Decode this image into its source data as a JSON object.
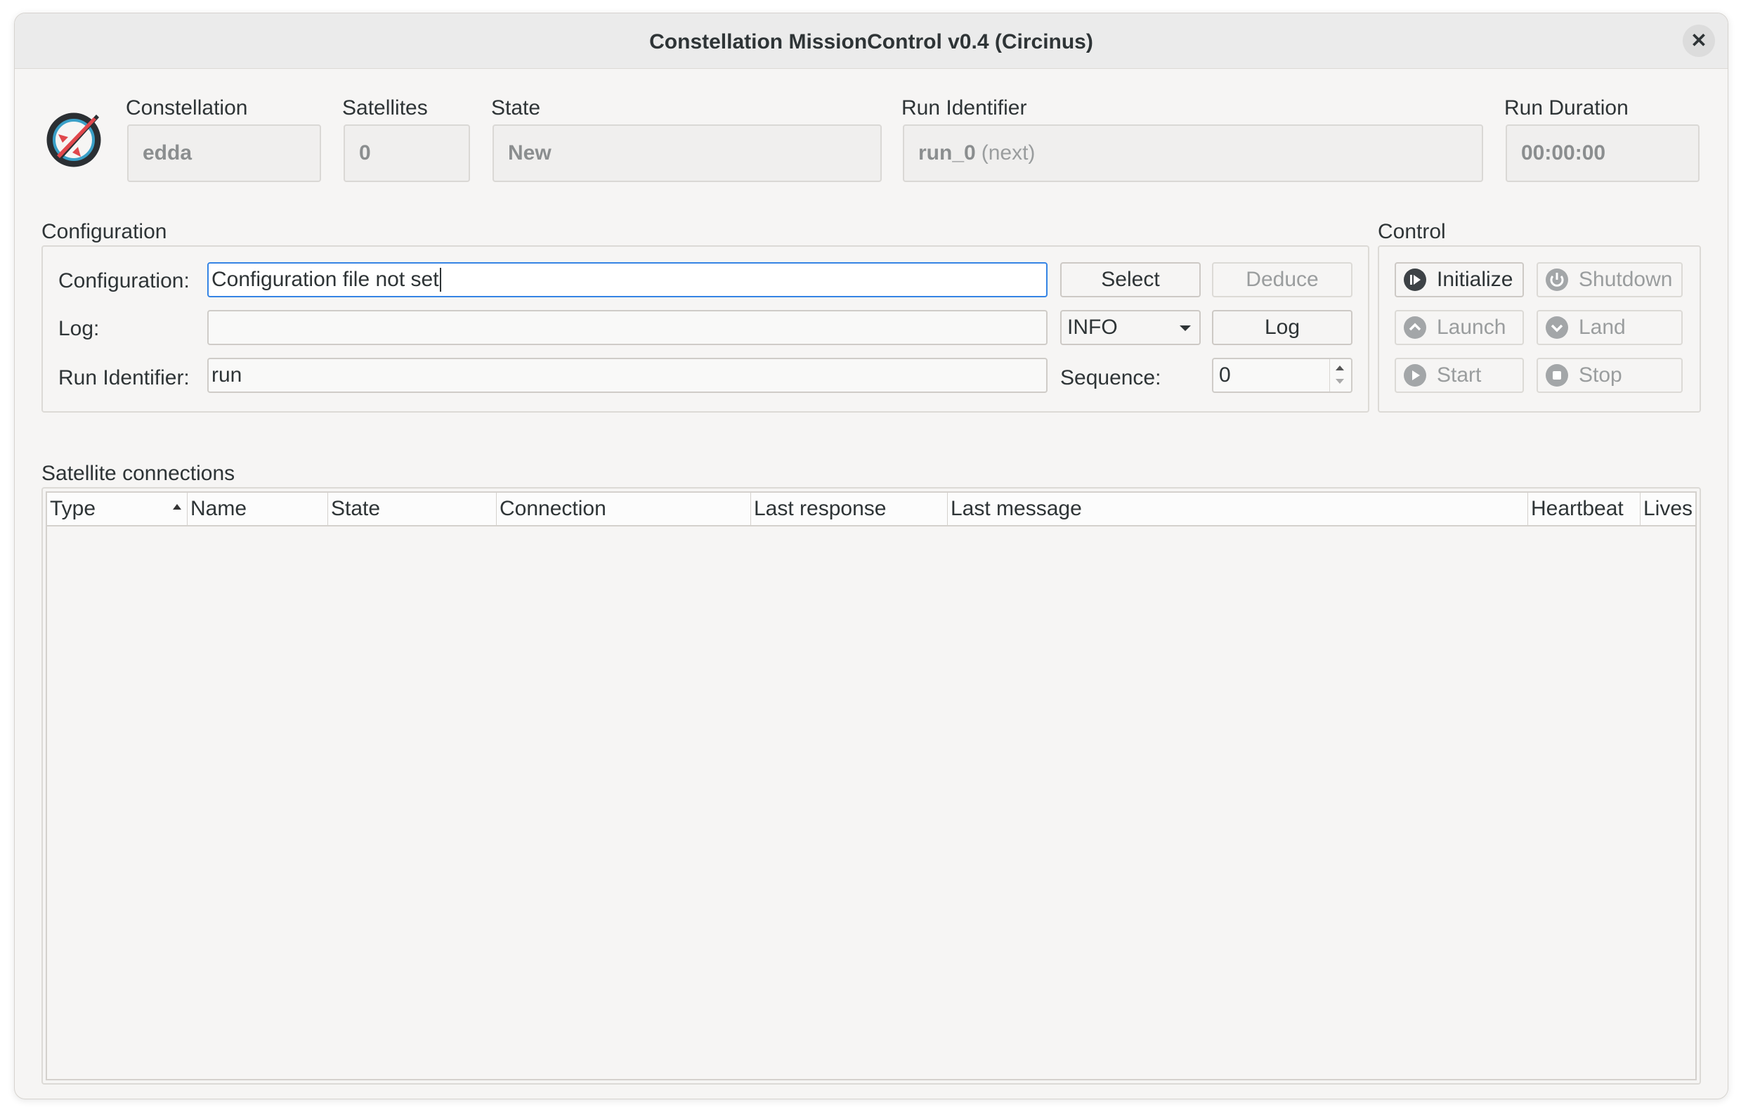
{
  "window": {
    "title": "Constellation MissionControl v0.4 (Circinus)",
    "close_glyph": "✕"
  },
  "header": {
    "constellation": {
      "label": "Constellation",
      "value": "edda"
    },
    "satellites": {
      "label": "Satellites",
      "value": "0"
    },
    "state": {
      "label": "State",
      "value": "New"
    },
    "run_identifier": {
      "label": "Run Identifier",
      "value": "run_0",
      "suffix": "(next)"
    },
    "run_duration": {
      "label": "Run Duration",
      "value": "00:00:00"
    }
  },
  "configuration": {
    "group_title": "Configuration",
    "config_label": "Configuration:",
    "config_value": "Configuration file not set",
    "select_label": "Select",
    "deduce_label": "Deduce",
    "log_label": "Log:",
    "log_value": "",
    "log_level": "INFO",
    "log_button": "Log",
    "run_id_label": "Run Identifier:",
    "run_id_value": "run",
    "sequence_label": "Sequence:",
    "sequence_value": "0"
  },
  "control": {
    "group_title": "Control",
    "buttons": [
      {
        "label": "Initialize",
        "icon": "initialize-icon",
        "enabled": true
      },
      {
        "label": "Shutdown",
        "icon": "power-icon",
        "enabled": false
      },
      {
        "label": "Launch",
        "icon": "launch-icon",
        "enabled": false
      },
      {
        "label": "Land",
        "icon": "land-icon",
        "enabled": false
      },
      {
        "label": "Start",
        "icon": "play-icon",
        "enabled": false
      },
      {
        "label": "Stop",
        "icon": "stop-icon",
        "enabled": false
      }
    ]
  },
  "satellites_table": {
    "group_title": "Satellite connections",
    "columns": [
      "Type",
      "Name",
      "State",
      "Connection",
      "Last response",
      "Last message",
      "Heartbeat",
      "Lives"
    ],
    "sorted_column": "Type",
    "rows": []
  },
  "colors": {
    "accent": "#3584e4",
    "logo_red": "#e0474c",
    "logo_blue": "#3aa0c8",
    "logo_dark": "#2b2f33"
  }
}
